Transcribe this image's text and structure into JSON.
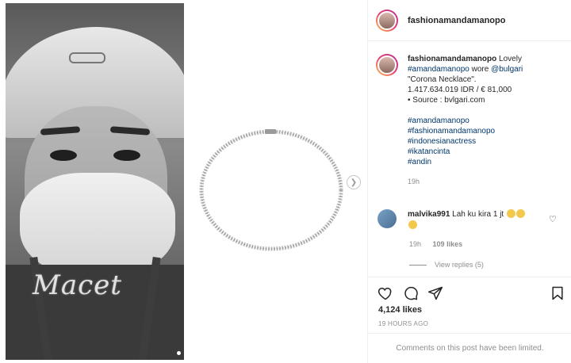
{
  "post": {
    "username": "fashionamandamanopo",
    "caption": {
      "username": "fashionamandamanopo",
      "intro": "Lovely",
      "tag1": "#amandamanopo",
      "wore": "wore",
      "mention": "@bulgari",
      "title": "\"Corona Necklace\".",
      "price": "1.417.634.019 IDR / € 81,000",
      "source": "• Source : bvlgari.com",
      "hashtags": [
        "#amandamanopo",
        "#fashionamandamanopo",
        "#indonesianactress",
        "#ikatancinta",
        "#andin"
      ],
      "time": "19h"
    },
    "comment": {
      "username": "malvika991",
      "text": "Lah ku kira 1 jt",
      "time": "19h",
      "likes": "109 likes",
      "view_replies": "View replies (5)"
    },
    "likes": "4,124 likes",
    "posted_ago": "19 HOURS AGO",
    "comments_disabled": "Comments on this post have been limited.",
    "photo_sticker": "Macet"
  },
  "icons": {
    "like": "heart-icon",
    "comment": "comment-icon",
    "share": "share-icon",
    "save": "bookmark-icon",
    "next": "chevron-right-icon"
  },
  "colors": {
    "link": "#00376b",
    "muted": "#8e8e8e",
    "text": "#262626",
    "border": "#efefef"
  }
}
